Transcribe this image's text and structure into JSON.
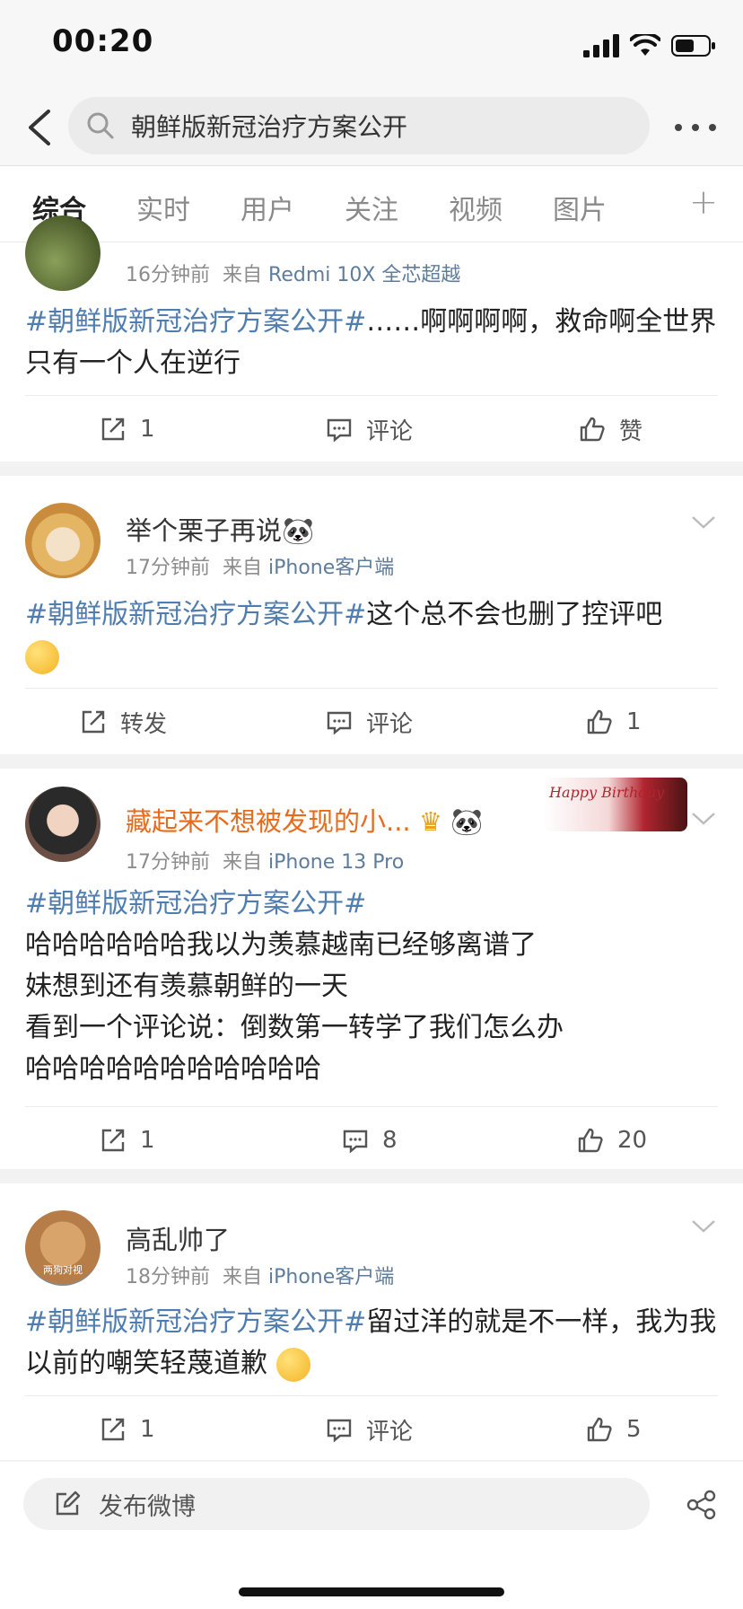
{
  "status_bar": {
    "time": "00:20"
  },
  "search": {
    "query": "朝鲜版新冠治疗方案公开"
  },
  "tabs": [
    "综合",
    "实时",
    "用户",
    "关注",
    "视频",
    "图片"
  ],
  "posts": [
    {
      "meta_time": "16分钟前",
      "meta_from": "来自",
      "meta_source": "Redmi 10X 全芯超越",
      "hashtag": "#朝鲜版新冠治疗方案公开#",
      "text": "……啊啊啊啊，救命啊全世界只有一个人在逆行",
      "repost": "1",
      "comment": "评论",
      "like": "赞"
    },
    {
      "name": "举个栗子再说🐼",
      "meta_time": "17分钟前",
      "meta_from": "来自",
      "meta_source": "iPhone客户端",
      "hashtag": "#朝鲜版新冠治疗方案公开#",
      "text": "这个总不会也删了控评吧",
      "repost": "转发",
      "comment": "评论",
      "like": "1"
    },
    {
      "name": "藏起来不想被发现的小...",
      "badge": "Happy Birthday",
      "meta_time": "17分钟前",
      "meta_from": "来自",
      "meta_source": "iPhone 13 Pro",
      "hashtag": "#朝鲜版新冠治疗方案公开#",
      "lines": [
        "哈哈哈哈哈哈我以为羡慕越南已经够离谱了",
        "妹想到还有羡慕朝鲜的一天",
        "看到一个评论说：倒数第一转学了我们怎么办",
        "哈哈哈哈哈哈哈哈哈哈哈"
      ],
      "repost": "1",
      "comment": "8",
      "like": "20"
    },
    {
      "name": "高乱帅了",
      "avatar_caption": "两狗对视",
      "meta_time": "18分钟前",
      "meta_from": "来自",
      "meta_source": "iPhone客户端",
      "hashtag": "#朝鲜版新冠治疗方案公开#",
      "text": "留过洋的就是不一样，我为我以前的嘲笑轻蔑道歉",
      "repost": "1",
      "comment": "评论",
      "like": "5"
    }
  ],
  "bottom": {
    "compose_label": "发布微博"
  },
  "colors": {
    "accent": "#ff8200",
    "hashtag": "#507daf",
    "vip_name": "#e86b1c"
  }
}
